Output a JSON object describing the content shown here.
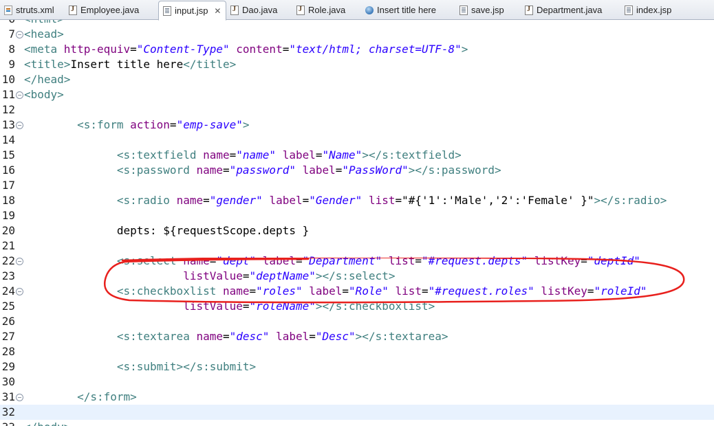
{
  "tabs": [
    {
      "label": "struts.xml",
      "icon": "xml-file-icon",
      "active": false
    },
    {
      "label": "Employee.java",
      "icon": "java-file-icon",
      "active": false
    },
    {
      "label": "input.jsp",
      "icon": "jsp-file-icon",
      "active": true
    },
    {
      "label": "Dao.java",
      "icon": "java-file-icon",
      "active": false
    },
    {
      "label": "Role.java",
      "icon": "java-file-icon",
      "active": false
    },
    {
      "label": "Insert title here",
      "icon": "web-browser-icon",
      "active": false
    },
    {
      "label": "save.jsp",
      "icon": "jsp-file-icon",
      "active": false
    },
    {
      "label": "Department.java",
      "icon": "java-file-icon",
      "active": false
    },
    {
      "label": "index.jsp",
      "icon": "jsp-file-icon",
      "active": false
    }
  ],
  "close_glyph": "✕",
  "fold_glyph": "⊖",
  "annotation_color": "#e8201d",
  "lines": [
    {
      "num": "6",
      "fold": false,
      "segs": [
        [
          "tg",
          "<html>"
        ]
      ]
    },
    {
      "num": "7",
      "fold": true,
      "segs": [
        [
          "tg",
          "<head>"
        ]
      ]
    },
    {
      "num": "8",
      "fold": false,
      "segs": [
        [
          "tg",
          "<meta "
        ],
        [
          "at",
          "http-equiv"
        ],
        [
          "tx",
          "="
        ],
        [
          "vl",
          "\"Content-Type\""
        ],
        [
          "tx",
          " "
        ],
        [
          "at",
          "content"
        ],
        [
          "tx",
          "="
        ],
        [
          "vl",
          "\"text/html; charset=UTF-8\""
        ],
        [
          "tg",
          ">"
        ]
      ]
    },
    {
      "num": "9",
      "fold": false,
      "segs": [
        [
          "tg",
          "<title>"
        ],
        [
          "tx",
          "Insert title here"
        ],
        [
          "tg",
          "</title>"
        ]
      ]
    },
    {
      "num": "10",
      "fold": false,
      "segs": [
        [
          "tg",
          "</head>"
        ]
      ]
    },
    {
      "num": "11",
      "fold": true,
      "segs": [
        [
          "tg",
          "<body>"
        ]
      ]
    },
    {
      "num": "12",
      "fold": false,
      "segs": []
    },
    {
      "num": "13",
      "fold": true,
      "segs": [
        [
          "tx",
          "        "
        ],
        [
          "tg",
          "<s:form "
        ],
        [
          "at",
          "action"
        ],
        [
          "tx",
          "="
        ],
        [
          "vl",
          "\"emp-save\""
        ],
        [
          "tg",
          ">"
        ]
      ]
    },
    {
      "num": "14",
      "fold": false,
      "segs": []
    },
    {
      "num": "15",
      "fold": false,
      "segs": [
        [
          "tx",
          "              "
        ],
        [
          "tg",
          "<s:textfield "
        ],
        [
          "at",
          "name"
        ],
        [
          "tx",
          "="
        ],
        [
          "vl",
          "\"name\""
        ],
        [
          "tx",
          " "
        ],
        [
          "at",
          "label"
        ],
        [
          "tx",
          "="
        ],
        [
          "vl",
          "\"Name\""
        ],
        [
          "tg",
          "></s:textfield>"
        ]
      ]
    },
    {
      "num": "16",
      "fold": false,
      "segs": [
        [
          "tx",
          "              "
        ],
        [
          "tg",
          "<s:password "
        ],
        [
          "at",
          "name"
        ],
        [
          "tx",
          "="
        ],
        [
          "vl",
          "\"password\""
        ],
        [
          "tx",
          " "
        ],
        [
          "at",
          "label"
        ],
        [
          "tx",
          "="
        ],
        [
          "vl",
          "\"PassWord\""
        ],
        [
          "tg",
          "></s:password>"
        ]
      ]
    },
    {
      "num": "17",
      "fold": false,
      "segs": []
    },
    {
      "num": "18",
      "fold": false,
      "segs": [
        [
          "tx",
          "              "
        ],
        [
          "tg",
          "<s:radio "
        ],
        [
          "at",
          "name"
        ],
        [
          "tx",
          "="
        ],
        [
          "vl",
          "\"gender\""
        ],
        [
          "tx",
          " "
        ],
        [
          "at",
          "label"
        ],
        [
          "tx",
          "="
        ],
        [
          "vl",
          "\"Gender\""
        ],
        [
          "tx",
          " "
        ],
        [
          "at",
          "list"
        ],
        [
          "tx",
          "=\"#{'1':'Male','2':'Female' }\""
        ],
        [
          "tg",
          "></s:radio>"
        ]
      ]
    },
    {
      "num": "19",
      "fold": false,
      "segs": []
    },
    {
      "num": "20",
      "fold": false,
      "segs": [
        [
          "tx",
          "              depts: ${requestScope.depts }"
        ]
      ]
    },
    {
      "num": "21",
      "fold": false,
      "segs": []
    },
    {
      "num": "22",
      "fold": true,
      "segs": [
        [
          "tx",
          "              "
        ],
        [
          "tg",
          "<s:select "
        ],
        [
          "at",
          "name"
        ],
        [
          "tx",
          "="
        ],
        [
          "vl",
          "\"dept\""
        ],
        [
          "tx",
          " "
        ],
        [
          "at",
          "label"
        ],
        [
          "tx",
          "="
        ],
        [
          "vl",
          "\"Department\""
        ],
        [
          "tx",
          " "
        ],
        [
          "at",
          "list"
        ],
        [
          "tx",
          "="
        ],
        [
          "vl",
          "\"#request.depts\""
        ],
        [
          "tx",
          " "
        ],
        [
          "at",
          "listKey"
        ],
        [
          "tx",
          "="
        ],
        [
          "vl",
          "\"deptId\""
        ]
      ]
    },
    {
      "num": "23",
      "fold": false,
      "segs": [
        [
          "tx",
          "                        "
        ],
        [
          "at",
          "listValue"
        ],
        [
          "tx",
          "="
        ],
        [
          "vl",
          "\"deptName\""
        ],
        [
          "tg",
          "></s:select>"
        ]
      ]
    },
    {
      "num": "24",
      "fold": true,
      "segs": [
        [
          "tx",
          "              "
        ],
        [
          "tg",
          "<s:checkboxlist "
        ],
        [
          "at",
          "name"
        ],
        [
          "tx",
          "="
        ],
        [
          "vl",
          "\"roles\""
        ],
        [
          "tx",
          " "
        ],
        [
          "at",
          "label"
        ],
        [
          "tx",
          "="
        ],
        [
          "vl",
          "\"Role\""
        ],
        [
          "tx",
          " "
        ],
        [
          "at",
          "list"
        ],
        [
          "tx",
          "="
        ],
        [
          "vl",
          "\"#request.roles\""
        ],
        [
          "tx",
          " "
        ],
        [
          "at",
          "listKey"
        ],
        [
          "tx",
          "="
        ],
        [
          "vl",
          "\"roleId\""
        ]
      ]
    },
    {
      "num": "25",
      "fold": false,
      "segs": [
        [
          "tx",
          "                        "
        ],
        [
          "at",
          "listValue"
        ],
        [
          "tx",
          "="
        ],
        [
          "vl",
          "\"roleName\""
        ],
        [
          "tg",
          "></s:checkboxlist>"
        ]
      ]
    },
    {
      "num": "26",
      "fold": false,
      "segs": []
    },
    {
      "num": "27",
      "fold": false,
      "segs": [
        [
          "tx",
          "              "
        ],
        [
          "tg",
          "<s:textarea "
        ],
        [
          "at",
          "name"
        ],
        [
          "tx",
          "="
        ],
        [
          "vl",
          "\"desc\""
        ],
        [
          "tx",
          " "
        ],
        [
          "at",
          "label"
        ],
        [
          "tx",
          "="
        ],
        [
          "vl",
          "\"Desc\""
        ],
        [
          "tg",
          "></s:textarea>"
        ]
      ]
    },
    {
      "num": "28",
      "fold": false,
      "segs": []
    },
    {
      "num": "29",
      "fold": false,
      "segs": [
        [
          "tx",
          "              "
        ],
        [
          "tg",
          "<s:submit></s:submit>"
        ]
      ]
    },
    {
      "num": "30",
      "fold": false,
      "segs": []
    },
    {
      "num": "31",
      "fold": true,
      "segs": [
        [
          "tx",
          "        "
        ],
        [
          "tg",
          "</s:form>"
        ]
      ]
    },
    {
      "num": "32",
      "fold": false,
      "current": true,
      "segs": []
    },
    {
      "num": "33",
      "fold": false,
      "segs": [
        [
          "tg",
          "</body>"
        ]
      ]
    }
  ]
}
